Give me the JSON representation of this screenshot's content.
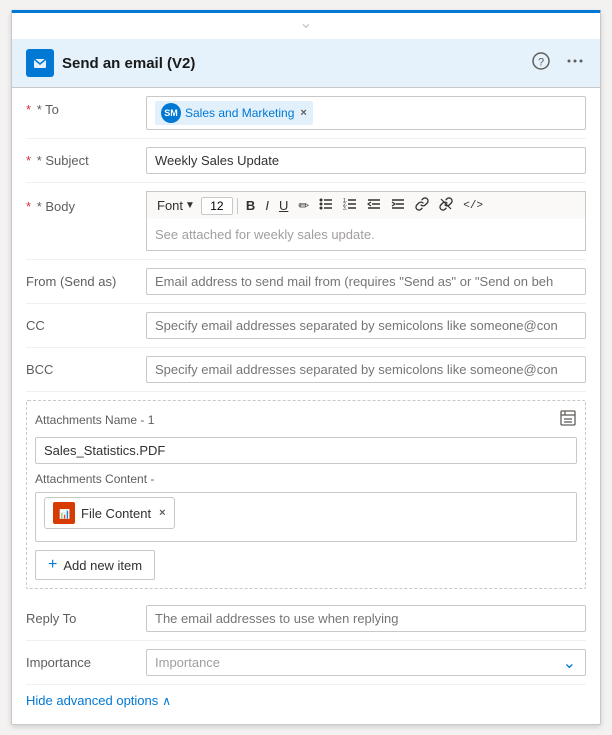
{
  "header": {
    "title": "Send an email (V2)",
    "app_icon_text": "✉",
    "help_icon": "?",
    "more_icon": "•••"
  },
  "top_chevron": "⌄",
  "fields": {
    "to_label": "* To",
    "to_tag": {
      "initials": "SM",
      "name": "Sales and Marketing"
    },
    "subject_label": "* Subject",
    "subject_value": "Weekly Sales Update",
    "body_label": "* Body",
    "font_label": "Font",
    "font_size": "12",
    "body_text": "See attached for weekly sales update.",
    "from_label": "From (Send as)",
    "from_placeholder": "Email address to send mail from (requires \"Send as\" or \"Send on beh",
    "cc_label": "CC",
    "cc_placeholder": "Specify email addresses separated by semicolons like someone@con",
    "bcc_label": "BCC",
    "bcc_placeholder": "Specify email addresses separated by semicolons like someone@con",
    "reply_to_label": "Reply To",
    "reply_to_placeholder": "The email addresses to use when replying",
    "importance_label": "Importance",
    "importance_placeholder": "Importance"
  },
  "attachments": {
    "name_label": "Attachments Name - 1",
    "name_value": "Sales_Statistics.PDF",
    "content_label": "Attachments Content -",
    "file_content_label": "File Content",
    "add_new_label": "Add new item"
  },
  "hide_advanced": "Hide advanced options",
  "toolbar": {
    "bold": "B",
    "italic": "I",
    "underline": "U",
    "pencil": "✏",
    "ul": "≡",
    "ol": "≡",
    "indent_less": "⇤",
    "indent_more": "⇥",
    "link": "🔗",
    "unlink": "🔗",
    "code": "</>"
  }
}
